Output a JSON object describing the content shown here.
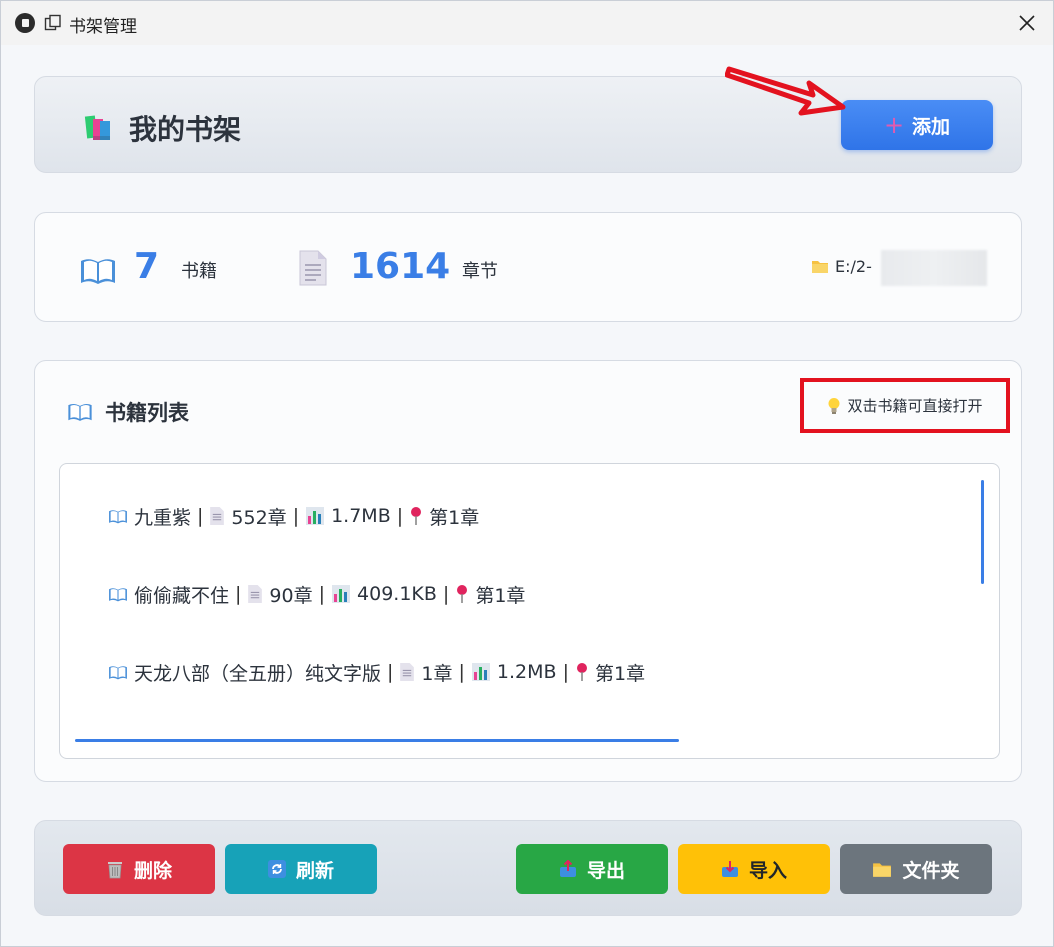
{
  "window": {
    "title": "书架管理",
    "icons": [
      "app-icon",
      "restore-icon",
      "close-icon"
    ]
  },
  "header": {
    "icon": "books-icon",
    "title": "我的书架",
    "add_button_label": "添加",
    "add_icon": "plus-icon"
  },
  "stats": {
    "books_count": "7",
    "books_label": "书籍",
    "books_icon": "open-book-icon",
    "chapters_count": "1614",
    "chapters_label": "章节",
    "chapters_icon": "document-icon",
    "path": "E:/2-",
    "path_icon": "folder-icon"
  },
  "book_list": {
    "icon": "open-book-icon",
    "title": "书籍列表",
    "hint": "双击书籍可直接打开",
    "hint_icon": "lightbulb-icon",
    "items": [
      {
        "name": "九重紫",
        "chapters": "552章",
        "size": "1.7MB",
        "progress": "第1章"
      },
      {
        "name": "偷偷藏不住",
        "chapters": "90章",
        "size": "409.1KB",
        "progress": "第1章"
      },
      {
        "name": "天龙八部（全五册）纯文字版",
        "chapters": "1章",
        "size": "1.2MB",
        "progress": "第1章"
      }
    ]
  },
  "footer": {
    "delete_label": "删除",
    "refresh_label": "刷新",
    "export_label": "导出",
    "import_label": "导入",
    "folder_label": "文件夹",
    "colors": {
      "delete": "#dc3545",
      "refresh": "#17a2b8",
      "export": "#28a745",
      "import": "#ffc107",
      "folder": "#6c757d"
    }
  },
  "colors": {
    "accent": "#3a7ee6",
    "annotation_red": "#e3121f"
  }
}
